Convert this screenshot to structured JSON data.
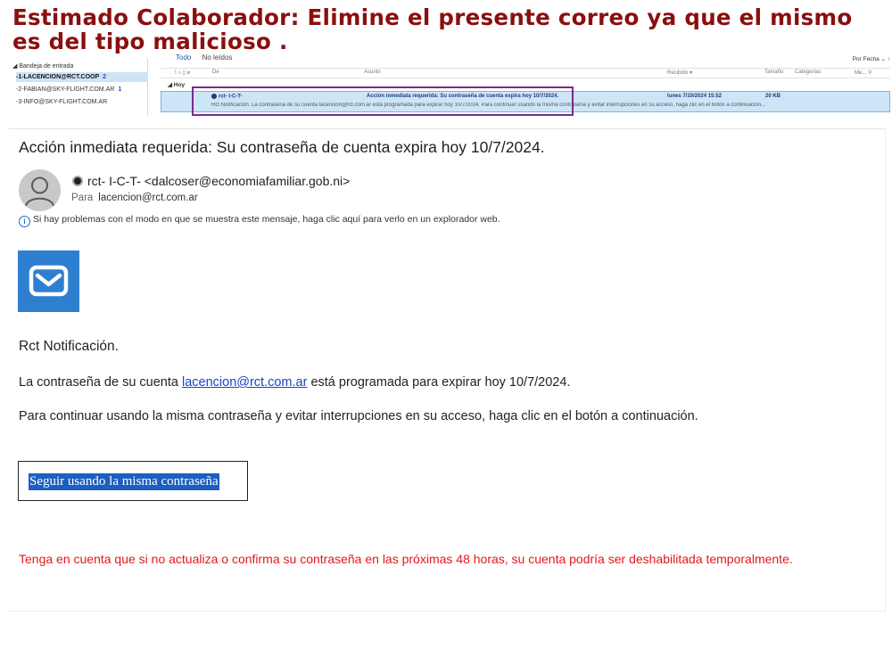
{
  "warning_banner": "Estimado Colaborador: Elimine el presente correo ya que el mismo es del tipo malicioso .",
  "outlook": {
    "folders": {
      "inbox": "◢ Bandeja de entrada",
      "accounts": [
        {
          "label": "-1-LACENCION@RCT.COOP",
          "count": "2"
        },
        {
          "label": "-2-FABIAN@SKY-FLIGHT.COM.AR",
          "count": "1"
        },
        {
          "label": "-3-INFO@SKY-FLIGHT.COM.AR",
          "count": ""
        }
      ]
    },
    "tabs": {
      "all": "Todo",
      "unread": "No leídos"
    },
    "sort": "Por Fecha ⌄  ↑",
    "columns": {
      "from": "De",
      "subject": "Asunto",
      "received": "Recibido ▾",
      "size": "Tamaño",
      "categories": "Categorías",
      "mention": "Me... ⚲"
    },
    "group": "◢ Hoy",
    "message": {
      "from": "rct- I-C-T-",
      "subject": "Acción inmediata requerida: Su contraseña de cuenta expira hoy 10/7/2024.",
      "received": "lunes 7/10/2024 15:52",
      "size": "20 KB",
      "preview": "Rct Notificación.  La contraseña de su cuenta lacencion@rct.com.ar está programada para expirar hoy 10/7/2024.  Para continuar usando la misma contraseña y evitar interrupciones en su acceso, haga clic en el botón a continuación..."
    }
  },
  "email": {
    "subject": "Acción inmediata requerida: Su contraseña de cuenta expira hoy 10/7/2024.",
    "sender": "rct- I-C-T- <dalcoser@economiafamiliar.gob.ni>",
    "to_label": "Para",
    "to_value": "lacencion@rct.com.ar",
    "infobar": "Si hay problemas con el modo en que se muestra este mensaje, haga clic aquí para verlo en un explorador web.",
    "notification": "Rct Notificación.",
    "para2_before": "La contraseña de su cuenta ",
    "para2_link": "lacencion@rct.com.ar",
    "para2_after": " está programada para expirar hoy 10/7/2024.",
    "para3": "Para continuar usando la misma contraseña y evitar interrupciones en su acceso, haga clic en el botón a continuación.",
    "button": "Seguir usando la misma contraseña",
    "warning_red": "Tenga en cuenta que si no actualiza o confirma su contraseña en las próximas 48 horas, su cuenta podría ser deshabilitada temporalmente."
  },
  "colors": {
    "banner": "#8a0f0f",
    "link": "#1a44c8",
    "button_bg": "#1d5fbf",
    "alert_red": "#e5171b",
    "mail_icon_bg": "#2f7fd0",
    "highlight_box": "#7b2a8e"
  },
  "icons": {
    "avatar": "person-avatar-icon",
    "mail": "envelope-check-icon",
    "info": "info-icon"
  }
}
